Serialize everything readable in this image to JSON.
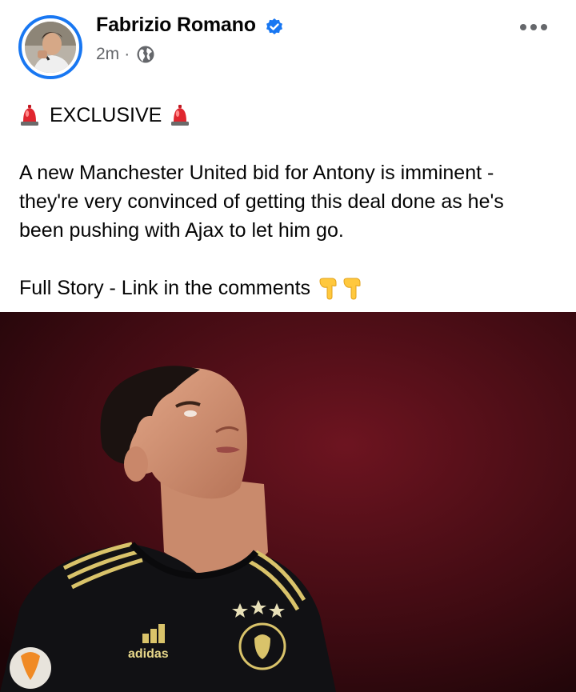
{
  "post": {
    "author": "Fabrizio Romano",
    "time": "2m",
    "separator": "·",
    "exclusive_label": "EXCLUSIVE",
    "paragraph": [
      "A new Manchester United bid for Antony is imminent -",
      "they're very convinced of getting this deal done as he's",
      "been pushing with Ajax to let him go."
    ],
    "cta": "Full Story - Link in the comments",
    "icons": {
      "verified": "verified-badge-icon",
      "privacy": "globe-icon",
      "menu": "more-options-icon",
      "siren": "police-siren-emoji",
      "pointing": "pointing-down-hand-emoji"
    },
    "colors": {
      "accent": "#1877f2",
      "meta": "#65676b",
      "text": "#050505"
    }
  },
  "photo": {
    "sponsor_text": "adidas"
  }
}
